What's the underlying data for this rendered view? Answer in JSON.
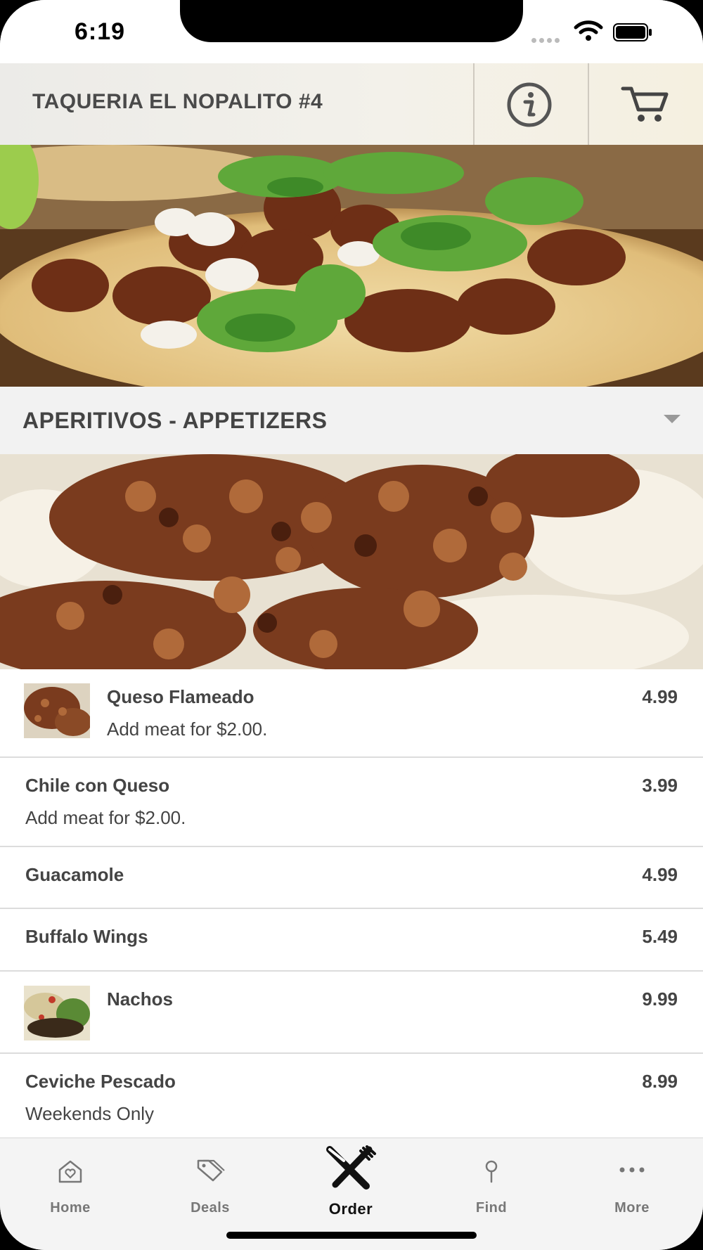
{
  "status_bar": {
    "time": "6:19"
  },
  "header": {
    "title": "TAQUERIA EL NOPALITO #4"
  },
  "section": {
    "title": "APERITIVOS - APPETIZERS"
  },
  "menu_items": [
    {
      "name": "Queso Flameado",
      "description": "Add meat for $2.00.",
      "price": "4.99"
    },
    {
      "name": "Chile con Queso",
      "description": "Add meat for $2.00.",
      "price": "3.99"
    },
    {
      "name": "Guacamole",
      "price": "4.99"
    },
    {
      "name": "Buffalo Wings",
      "price": "5.49"
    },
    {
      "name": "Nachos",
      "price": "9.99"
    },
    {
      "name": "Ceviche Pescado",
      "description": "Weekends Only",
      "price": "8.99"
    }
  ],
  "tabs": [
    {
      "label": "Home",
      "icon": "home-icon"
    },
    {
      "label": "Deals",
      "icon": "tag-icon"
    },
    {
      "label": "Order",
      "icon": "utensils-icon",
      "active": true
    },
    {
      "label": "Find",
      "icon": "location-pin-icon"
    },
    {
      "label": "More",
      "icon": "more-icon"
    }
  ]
}
